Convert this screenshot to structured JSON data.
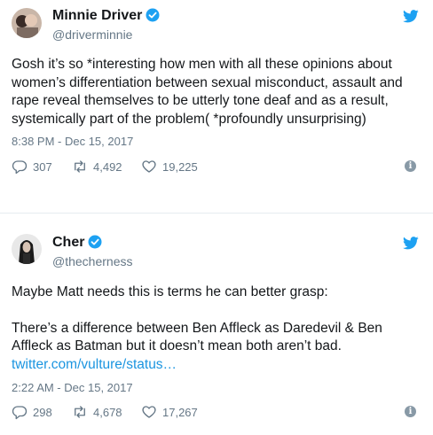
{
  "tweets": [
    {
      "name": "Minnie Driver",
      "handle": "@driverminnie",
      "text": "Gosh it’s so *interesting how men with all these opinions about women’s differentiation between sexual misconduct, assault and rape reveal themselves to be utterly tone deaf and as a result, systemically part of the problem( *profoundly unsurprising)",
      "timestamp": "8:38 PM - Dec 15, 2017",
      "replies": "307",
      "retweets": "4,492",
      "likes": "19,225"
    },
    {
      "name": "Cher",
      "handle": "@thecherness",
      "text_p1": "Maybe Matt needs this is terms he can better grasp:",
      "text_p2": "There’s a difference between Ben Affleck as Daredevil & Ben Affleck as Batman but it doesn’t mean both aren’t bad.",
      "link": "twitter.com/vulture/status…",
      "timestamp": "2:22 AM - Dec 15, 2017",
      "replies": "298",
      "retweets": "4,678",
      "likes": "17,267"
    }
  ],
  "icons": [
    "avatar",
    "verified-icon",
    "twitter-bird-icon",
    "reply-icon",
    "retweet-icon",
    "like-icon",
    "info-icon"
  ],
  "colors": {
    "accent": "#1da1f2",
    "link": "#1b95e0",
    "muted": "#657786",
    "text": "#14171a"
  }
}
